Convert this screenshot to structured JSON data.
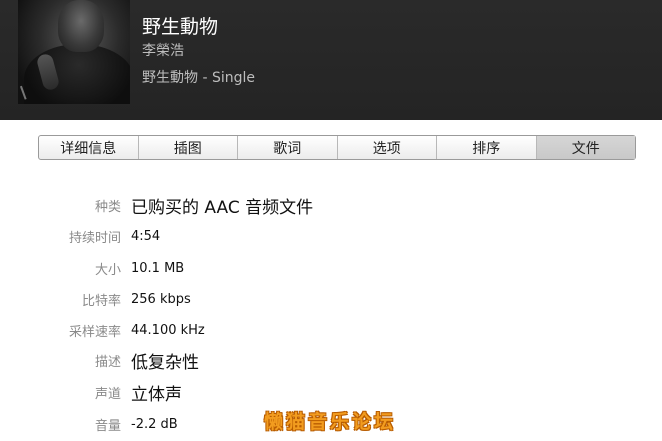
{
  "song": {
    "title": "野生動物",
    "artist": "李榮浩",
    "album": "野生動物 - Single"
  },
  "tabs": [
    {
      "label": "详细信息"
    },
    {
      "label": "插图"
    },
    {
      "label": "歌词"
    },
    {
      "label": "选项"
    },
    {
      "label": "排序"
    },
    {
      "label": "文件"
    }
  ],
  "active_tab": "文件",
  "file_info": [
    {
      "label": "种类",
      "value": "已购买的 AAC 音频文件"
    },
    {
      "label": "持续时间",
      "value": "4:54"
    },
    {
      "label": "大小",
      "value": "10.1 MB"
    },
    {
      "label": "比特率",
      "value": "256 kbps"
    },
    {
      "label": "采样速率",
      "value": "44.100 kHz"
    },
    {
      "label": "描述",
      "value": "低复杂性"
    },
    {
      "label": "声道",
      "value": "立体声"
    },
    {
      "label": "音量",
      "value": "-2.2 dB"
    }
  ],
  "watermark": "懒猫音乐论坛",
  "colors": {
    "header_bg": "#2a2a2a",
    "label_gray": "#8a8a8a",
    "watermark_orange": "#f29c1f"
  }
}
